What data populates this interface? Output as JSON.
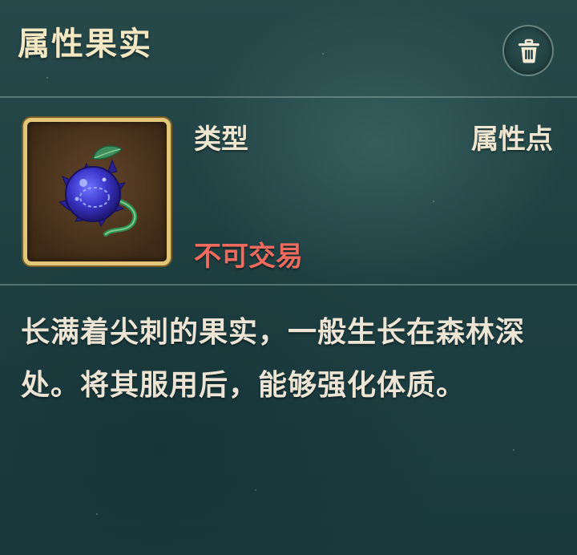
{
  "header": {
    "title": "属性果实"
  },
  "icons": {
    "delete": "trash-icon",
    "item": "spiked-berry-icon"
  },
  "item": {
    "type_label": "类型",
    "type_value": "属性点",
    "trade_status": "不可交易",
    "description": "长满着尖刺的果实，一般生长在森林深处。将其服用后，能够强化体质。"
  },
  "colors": {
    "title": "#f3e7c4",
    "text": "#efe6d2",
    "untradable": "#f06a5e",
    "frame_gold": "#e3c779",
    "panel_bg": "#1f4042"
  }
}
